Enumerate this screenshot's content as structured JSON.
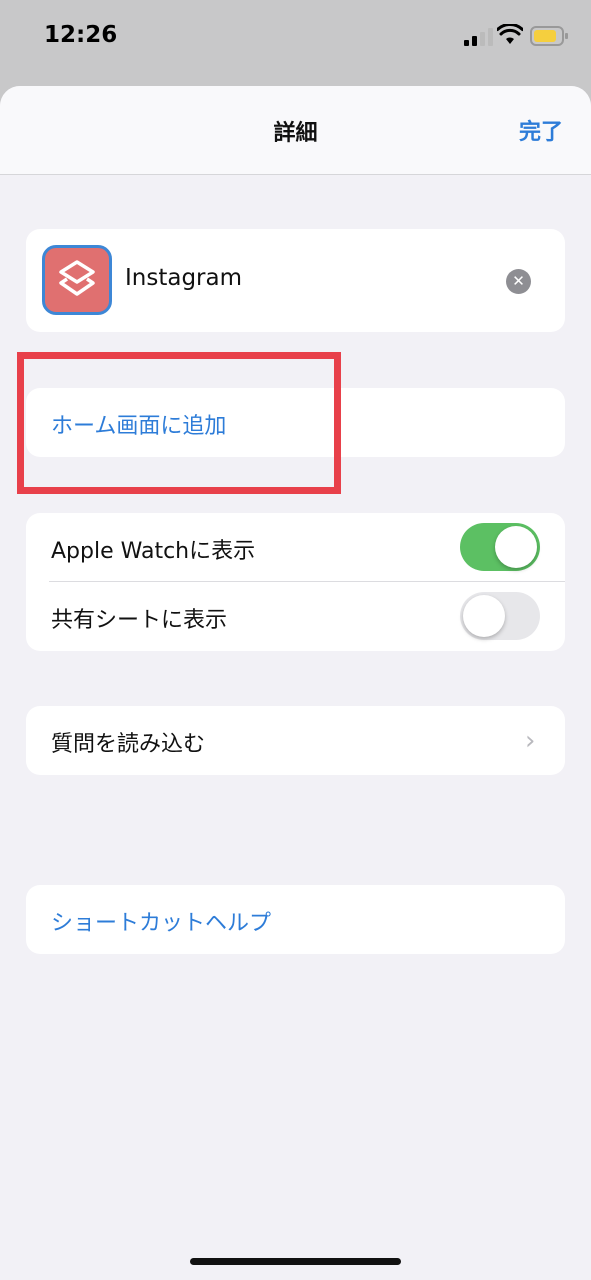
{
  "status_bar": {
    "time": "12:26"
  },
  "nav": {
    "title": "詳細",
    "done_label": "完了"
  },
  "shortcut": {
    "name": "Instagram",
    "icon": "shortcuts-layers-icon"
  },
  "home_screen": {
    "label": "ホーム画面に追加"
  },
  "toggles": [
    {
      "label": "Apple Watchに表示",
      "on": true
    },
    {
      "label": "共有シートに表示",
      "on": false
    }
  ],
  "import_questions": {
    "label": "質問を読み込む"
  },
  "help": {
    "label": "ショートカットヘルプ"
  },
  "colors": {
    "accent": "#2d7cd8",
    "toggle_on": "#5cc063",
    "highlight": "#e8404a",
    "icon_bg": "#e07070"
  }
}
